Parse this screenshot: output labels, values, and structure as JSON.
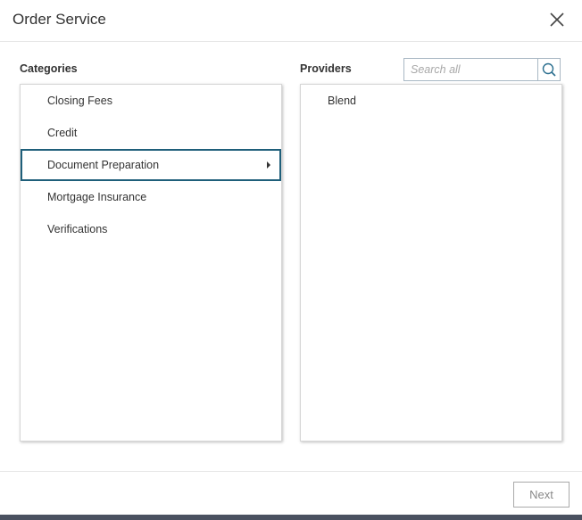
{
  "dialog": {
    "title": "Order Service"
  },
  "icons": {
    "close": "close-icon",
    "search": "search-icon",
    "arrow": "caret-right-icon"
  },
  "colors": {
    "selected_border": "#1f5f7a",
    "search_icon": "#2b6f8f",
    "footer_bar": "#4a5160"
  },
  "categories": {
    "label": "Categories",
    "items": [
      {
        "label": "Closing Fees"
      },
      {
        "label": "Credit"
      },
      {
        "label": "Document Preparation",
        "selected": true
      },
      {
        "label": "Mortgage Insurance"
      },
      {
        "label": "Verifications"
      }
    ]
  },
  "providers": {
    "label": "Providers",
    "search_placeholder": "Search all",
    "search_value": "",
    "items": [
      {
        "label": "Blend"
      }
    ]
  },
  "footer": {
    "next_label": "Next"
  }
}
